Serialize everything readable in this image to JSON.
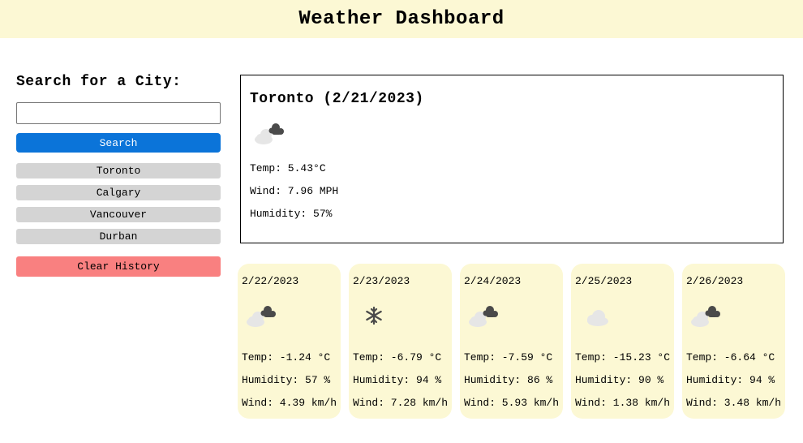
{
  "header": {
    "title": "Weather Dashboard"
  },
  "sidebar": {
    "heading": "Search for a City:",
    "search_value": "",
    "search_button": "Search",
    "history": [
      "Toronto",
      "Calgary",
      "Vancouver",
      "Durban"
    ],
    "clear_button": "Clear History"
  },
  "current": {
    "title": "Toronto (2/21/2023)",
    "icon": "cloudy-icon",
    "temp": "Temp: 5.43°C",
    "wind": "Wind: 7.96 MPH",
    "humidity": "Humidity: 57%"
  },
  "forecast": [
    {
      "date": "2/22/2023",
      "icon": "cloudy-icon",
      "temp": "Temp: -1.24 °C",
      "humidity": "Humidity: 57 %",
      "wind": "Wind: 4.39 km/h"
    },
    {
      "date": "2/23/2023",
      "icon": "snow-icon",
      "temp": "Temp: -6.79 °C",
      "humidity": "Humidity: 94 %",
      "wind": "Wind: 7.28 km/h"
    },
    {
      "date": "2/24/2023",
      "icon": "cloudy-icon",
      "temp": "Temp: -7.59 °C",
      "humidity": "Humidity: 86 %",
      "wind": "Wind: 5.93 km/h"
    },
    {
      "date": "2/25/2023",
      "icon": "cloud-icon",
      "temp": "Temp: -15.23 °C",
      "humidity": "Humidity: 90 %",
      "wind": "Wind: 1.38 km/h"
    },
    {
      "date": "2/26/2023",
      "icon": "cloudy-icon",
      "temp": "Temp: -6.64 °C",
      "humidity": "Humidity: 94 %",
      "wind": "Wind: 3.48 km/h"
    }
  ],
  "colors": {
    "header_bg": "#fcf8d4",
    "search_button": "#0b74d9",
    "history_button": "#d4d4d4",
    "clear_button": "#f98080",
    "card_bg": "#fcf8d4"
  }
}
